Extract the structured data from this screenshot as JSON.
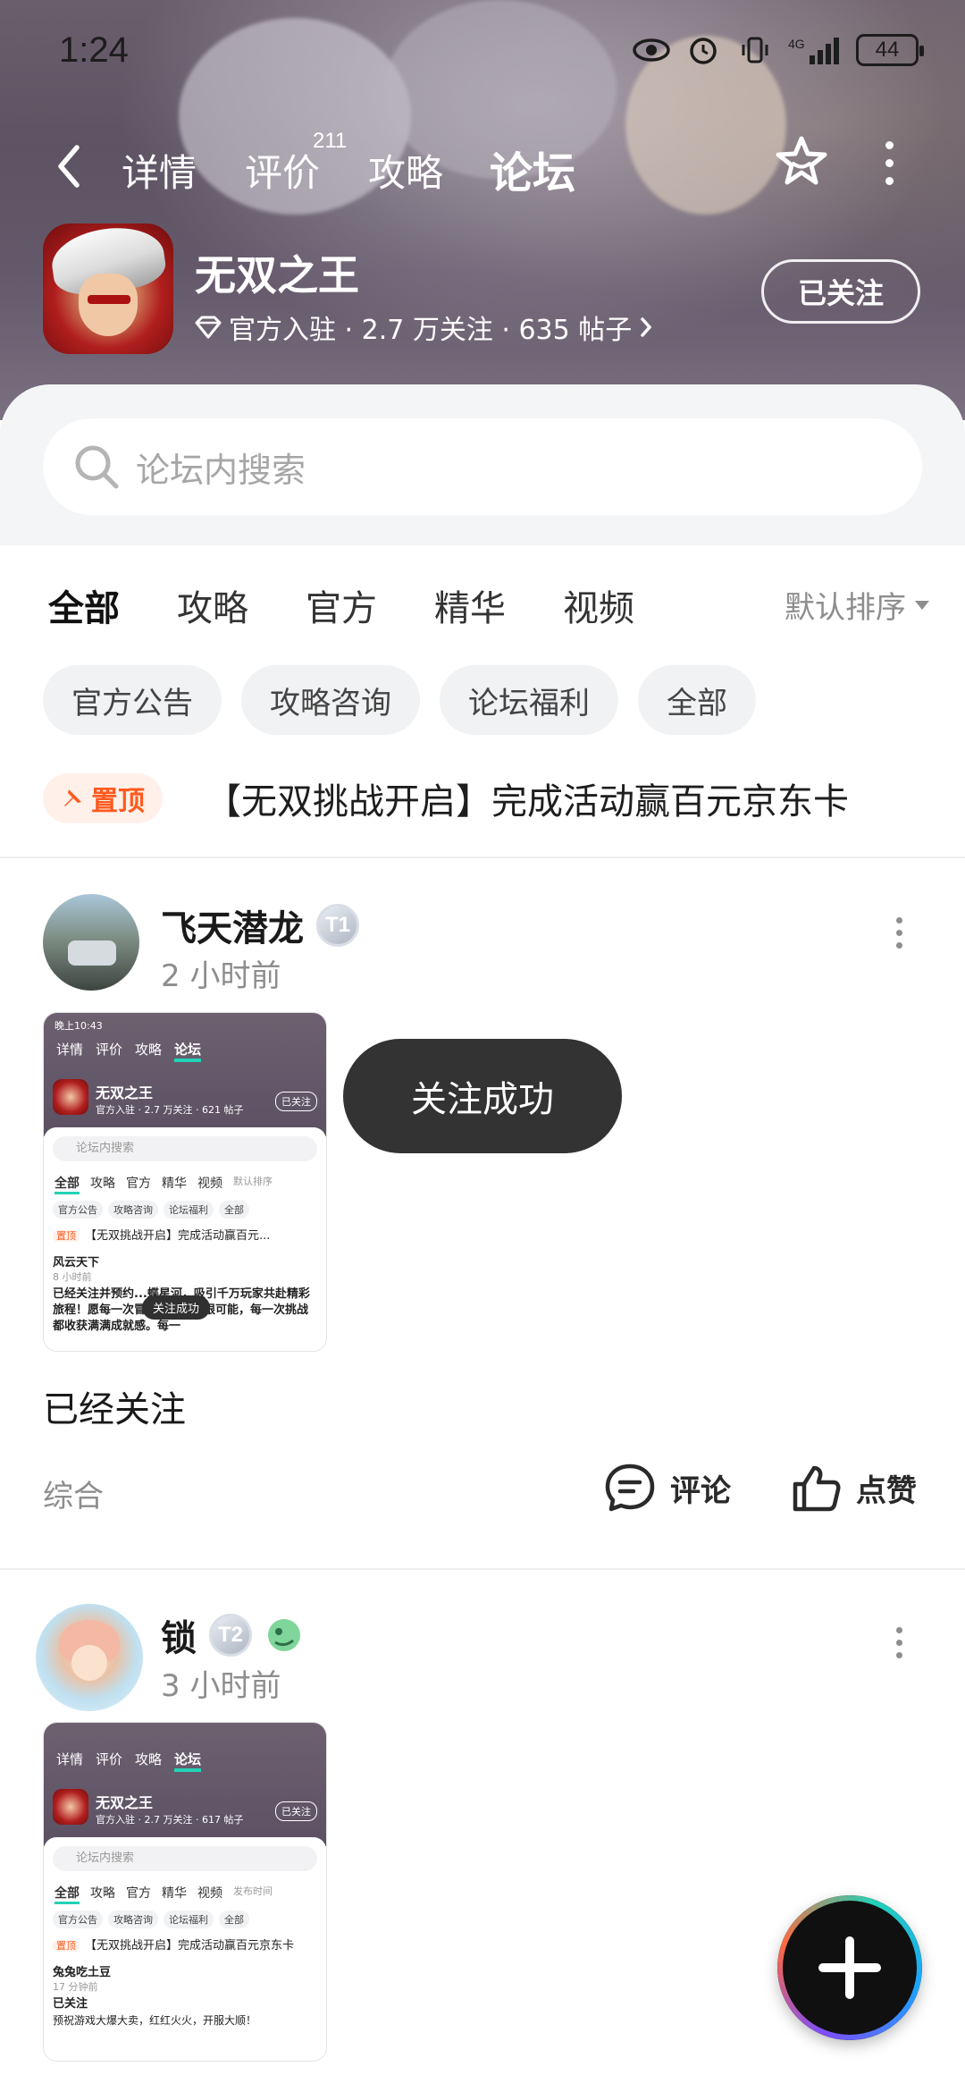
{
  "status_bar": {
    "time": "1:24",
    "network": "4G",
    "battery": "44"
  },
  "nav": {
    "tabs": [
      {
        "label": "详情",
        "active": false
      },
      {
        "label": "评价",
        "active": false
      },
      {
        "label": "攻略",
        "active": false
      },
      {
        "label": "论坛",
        "active": true
      }
    ],
    "review_count": "211"
  },
  "game": {
    "title": "无双之王",
    "meta": "官方入驻 · 2.7 万关注 · 635 帖子",
    "follow_label": "已关注"
  },
  "search": {
    "placeholder": "论坛内搜索"
  },
  "categories": {
    "tabs": [
      "全部",
      "攻略",
      "官方",
      "精华",
      "视频"
    ],
    "active": "全部",
    "sort_label": "默认排序"
  },
  "chips": [
    "官方公告",
    "攻略咨询",
    "论坛福利",
    "全部"
  ],
  "pinned": {
    "badge": "置顶",
    "title": "【无双挑战开启】完成活动赢百元京东卡"
  },
  "posts": [
    {
      "user": "飞天潜龙",
      "level": "T1",
      "time": "2 小时前",
      "text": "已经关注",
      "category": "综合",
      "comment_label": "评论",
      "like_label": "点赞",
      "thumb": {
        "time": "晚上10:43",
        "tabs": [
          "详情",
          "评价",
          "攻略",
          "论坛"
        ],
        "game": "无双之王",
        "meta": "官方入驻 · 2.7 万关注 · 621 帖子",
        "follow": "已关注",
        "search": "论坛内搜索",
        "cats": [
          "全部",
          "攻略",
          "官方",
          "精华",
          "视频",
          "默认排序"
        ],
        "chips": [
          "官方公告",
          "攻略咨询",
          "论坛福利",
          "全部"
        ],
        "pin_badge": "置顶",
        "pin": "【无双挑战开启】完成活动赢百元...",
        "user": "风云天下",
        "user_time": "8 小时前",
        "text": "已经关注并预约...蝶星河，吸引千万玩家共赴精彩旅程！愿每一次冒险都充满无限可能，每一次挑战都收获满满成就感。每一",
        "toast": "关注成功"
      }
    },
    {
      "user": "锁",
      "level": "T2",
      "time": "3 小时前",
      "thumb": {
        "tabs": [
          "详情",
          "评价",
          "攻略",
          "论坛"
        ],
        "game": "无双之王",
        "meta": "官方入驻 · 2.7 万关注 · 617 帖子",
        "follow": "已关注",
        "search": "论坛内搜索",
        "cats": [
          "全部",
          "攻略",
          "官方",
          "精华",
          "视频",
          "发布时间"
        ],
        "chips": [
          "官方公告",
          "攻略咨询",
          "论坛福利",
          "全部"
        ],
        "pin_badge": "置顶",
        "pin": "【无双挑战开启】完成活动赢百元京东卡",
        "user": "兔兔吃土豆",
        "user_time": "17 分钟前",
        "title": "已关注",
        "text": "预祝游戏大爆大卖，红红火火，开服大顺！"
      }
    }
  ],
  "toast": "关注成功",
  "colors": {
    "accent": "#23d2b7",
    "pin": "#ff5a1f"
  }
}
